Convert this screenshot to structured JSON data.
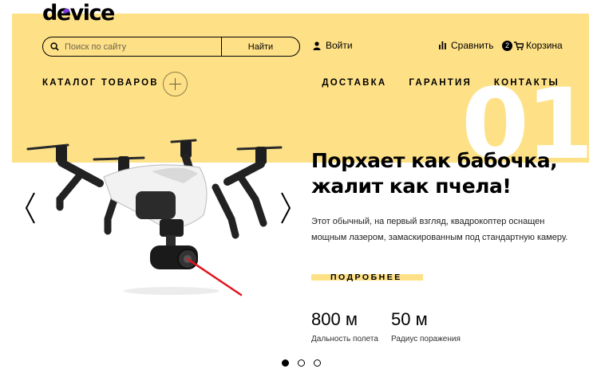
{
  "header": {
    "logo_text": "device",
    "search": {
      "placeholder": "Поиск по сайту",
      "button_label": "Найти"
    },
    "login_label": "Войти",
    "compare_label": "Сравнить",
    "cart": {
      "count": "2",
      "label": "Корзина"
    }
  },
  "nav": {
    "catalog_label": "КАТАЛОГ ТОВАРОВ",
    "items": [
      "ДОСТАВКА",
      "ГАРАНТИЯ",
      "КОНТАКТЫ"
    ]
  },
  "slide": {
    "number": "01",
    "headline_line1": "Порхает как бабочка,",
    "headline_line2": "жалит как пчела!",
    "description_line1": "Этот обычный, на первый взгляд, квадрокоптер оснащен",
    "description_line2": "мощным лазером, замаскированным под стандартную камеру.",
    "more_label": "ПОДРОБНЕЕ",
    "stats": [
      {
        "value": "800 м",
        "label": "Дальность полета"
      },
      {
        "value": "50 м",
        "label": "Радиус поражения"
      }
    ],
    "active_index": 0,
    "total": 3
  },
  "colors": {
    "accent_yellow": "#fee187",
    "logo_dot": "#7d3cdc",
    "laser": "#e0141e"
  }
}
